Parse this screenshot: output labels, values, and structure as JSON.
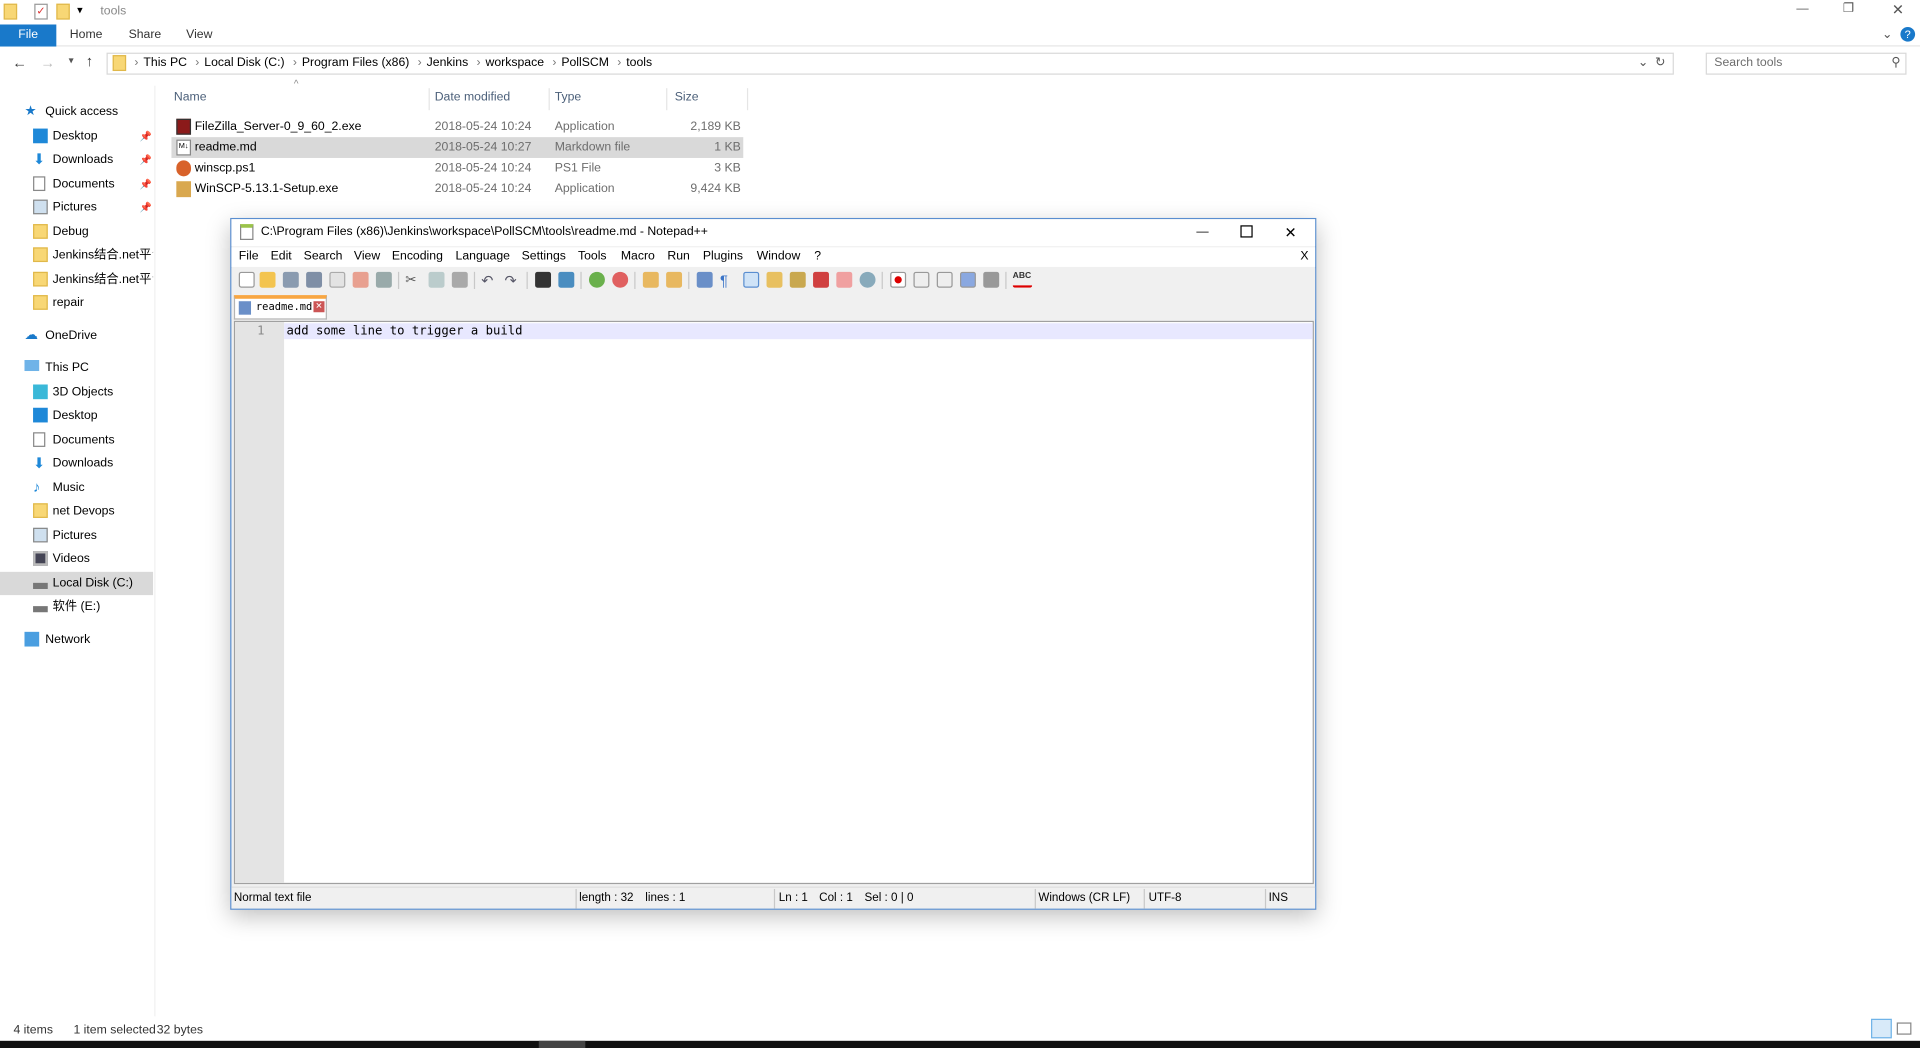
{
  "explorer": {
    "title": "tools",
    "ribbon_tabs": [
      "File",
      "Home",
      "Share",
      "View"
    ],
    "breadcrumb": [
      "This PC",
      "Local Disk (C:)",
      "Program Files (x86)",
      "Jenkins",
      "workspace",
      "PollSCM",
      "tools"
    ],
    "search_placeholder": "Search tools",
    "nav": {
      "quick_access": "Quick access",
      "quick_items": [
        "Desktop",
        "Downloads",
        "Documents",
        "Pictures",
        "Debug",
        "Jenkins结合.net平台",
        "Jenkins结合.net平台",
        "repair"
      ],
      "onedrive": "OneDrive",
      "this_pc": "This PC",
      "pc_items": [
        "3D Objects",
        "Desktop",
        "Documents",
        "Downloads",
        "Music",
        "net Devops",
        "Pictures",
        "Videos",
        "Local Disk (C:)",
        "软件 (E:)"
      ],
      "network": "Network"
    },
    "columns": [
      "Name",
      "Date modified",
      "Type",
      "Size"
    ],
    "files": [
      {
        "name": "FileZilla_Server-0_9_60_2.exe",
        "date": "2018-05-24 10:24",
        "type": "Application",
        "size": "2,189 KB"
      },
      {
        "name": "readme.md",
        "date": "2018-05-24 10:27",
        "type": "Markdown file",
        "size": "1 KB"
      },
      {
        "name": "winscp.ps1",
        "date": "2018-05-24 10:24",
        "type": "PS1 File",
        "size": "3 KB"
      },
      {
        "name": "WinSCP-5.13.1-Setup.exe",
        "date": "2018-05-24 10:24",
        "type": "Application",
        "size": "9,424 KB"
      }
    ],
    "status": {
      "count": "4 items",
      "selected": "1 item selected",
      "size": "32 bytes"
    }
  },
  "notepad": {
    "title": "C:\\Program Files (x86)\\Jenkins\\workspace\\PollSCM\\tools\\readme.md - Notepad++",
    "menu": [
      "File",
      "Edit",
      "Search",
      "View",
      "Encoding",
      "Language",
      "Settings",
      "Tools",
      "Macro",
      "Run",
      "Plugins",
      "Window",
      "?"
    ],
    "menu_close": "X",
    "tab": "readme.md",
    "line_number": "1",
    "line_text": "add some line to trigger a build",
    "status": {
      "type": "Normal text file",
      "length": "length : 32",
      "lines": "lines : 1",
      "ln": "Ln : 1",
      "col": "Col : 1",
      "sel": "Sel : 0 | 0",
      "eol": "Windows (CR LF)",
      "enc": "UTF-8",
      "mode": "INS"
    },
    "spell_icon": "ABC"
  }
}
